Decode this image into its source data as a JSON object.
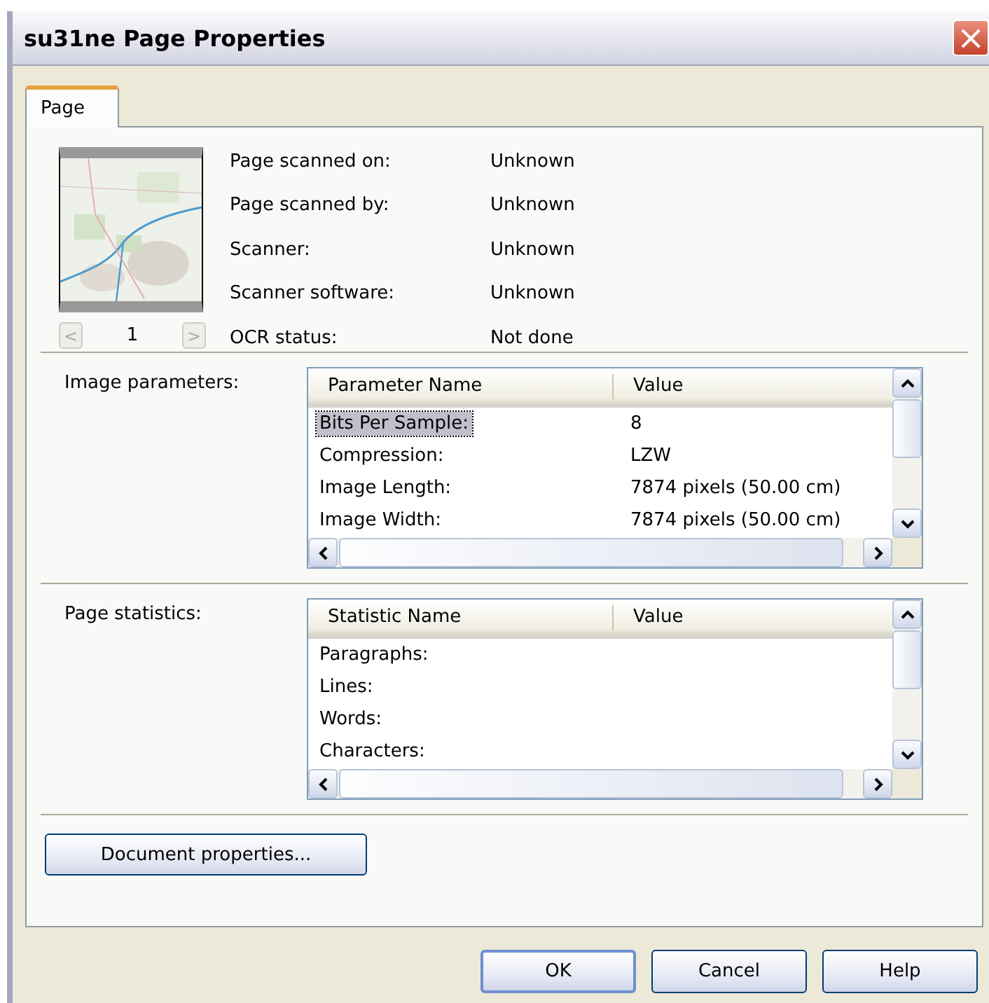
{
  "window": {
    "title": "su31ne Page Properties",
    "close": "×"
  },
  "tabs": [
    {
      "label": "Page",
      "selected": true
    }
  ],
  "thumbnail": {
    "page_number": "1",
    "prev": "<",
    "next": ">"
  },
  "info": [
    {
      "label": "Page scanned on:",
      "value": "Unknown"
    },
    {
      "label": "Page scanned by:",
      "value": "Unknown"
    },
    {
      "label": "Scanner:",
      "value": "Unknown"
    },
    {
      "label": "Scanner software:",
      "value": "Unknown"
    },
    {
      "label": "OCR status:",
      "value": "Not done"
    }
  ],
  "image_parameters": {
    "label": "Image parameters:",
    "columns": [
      "Parameter Name",
      "Value"
    ],
    "rows": [
      {
        "name": "Bits Per Sample:",
        "value": "8",
        "selected": true
      },
      {
        "name": "Compression:",
        "value": "LZW",
        "selected": false
      },
      {
        "name": "Image Length:",
        "value": "7874 pixels (50.00 cm)",
        "selected": false
      },
      {
        "name": "Image Width:",
        "value": "7874 pixels (50.00 cm)",
        "selected": false
      }
    ]
  },
  "page_statistics": {
    "label": "Page statistics:",
    "columns": [
      "Statistic Name",
      "Value"
    ],
    "rows": [
      {
        "name": "Paragraphs:",
        "value": "",
        "selected": false
      },
      {
        "name": "Lines:",
        "value": "",
        "selected": false
      },
      {
        "name": "Words:",
        "value": "",
        "selected": false
      },
      {
        "name": "Characters:",
        "value": "",
        "selected": false
      }
    ]
  },
  "document_button": "Document properties...",
  "buttons": [
    "OK",
    "Cancel",
    "Help"
  ]
}
